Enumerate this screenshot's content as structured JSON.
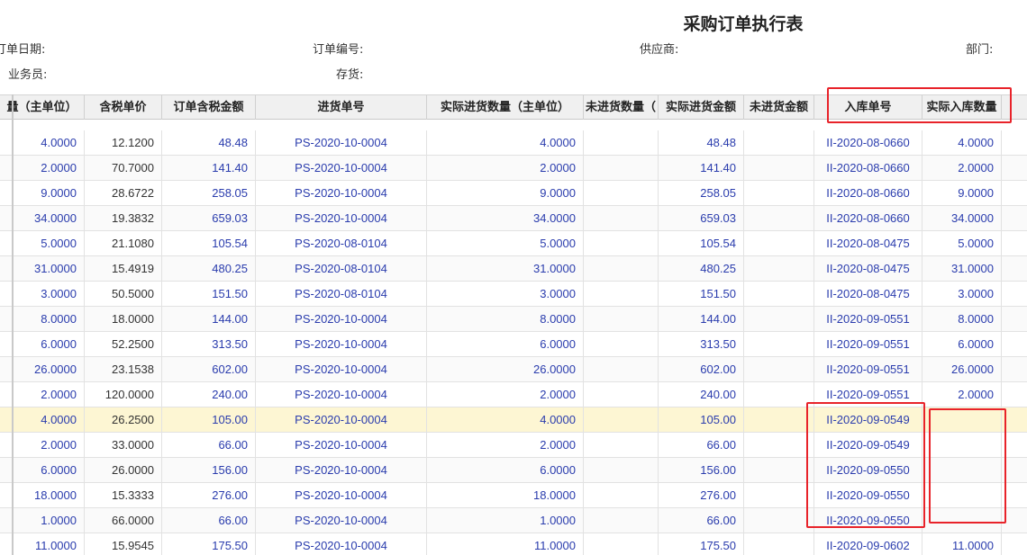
{
  "title": "采购订单执行表",
  "filters": {
    "order_date": "订单日期:",
    "order_no": "订单编号:",
    "supplier": "供应商:",
    "department": "部门:",
    "salesperson": "业务员:",
    "inventory": "存货:"
  },
  "columns": [
    "量（主单位）",
    "含税单价",
    "订单含税金额",
    "进货单号",
    "实际进货数量（主单位）",
    "未进货数量（",
    "实际进货金额",
    "未进货金额",
    "入库单号",
    "实际入库数量"
  ],
  "rows": [
    {
      "qty": "4.0000",
      "price": "12.1200",
      "amount": "48.48",
      "purchase_no": "PS-2020-10-0004",
      "actual_qty": "4.0000",
      "unpurchased_qty": "",
      "actual_amount": "48.48",
      "unpurchased_amount": "",
      "stockin_no": "II-2020-08-0660",
      "stockin_qty": "4.0000"
    },
    {
      "qty": "2.0000",
      "price": "70.7000",
      "amount": "141.40",
      "purchase_no": "PS-2020-10-0004",
      "actual_qty": "2.0000",
      "unpurchased_qty": "",
      "actual_amount": "141.40",
      "unpurchased_amount": "",
      "stockin_no": "II-2020-08-0660",
      "stockin_qty": "2.0000"
    },
    {
      "qty": "9.0000",
      "price": "28.6722",
      "amount": "258.05",
      "purchase_no": "PS-2020-10-0004",
      "actual_qty": "9.0000",
      "unpurchased_qty": "",
      "actual_amount": "258.05",
      "unpurchased_amount": "",
      "stockin_no": "II-2020-08-0660",
      "stockin_qty": "9.0000"
    },
    {
      "qty": "34.0000",
      "price": "19.3832",
      "amount": "659.03",
      "purchase_no": "PS-2020-10-0004",
      "actual_qty": "34.0000",
      "unpurchased_qty": "",
      "actual_amount": "659.03",
      "unpurchased_amount": "",
      "stockin_no": "II-2020-08-0660",
      "stockin_qty": "34.0000"
    },
    {
      "qty": "5.0000",
      "price": "21.1080",
      "amount": "105.54",
      "purchase_no": "PS-2020-08-0104",
      "actual_qty": "5.0000",
      "unpurchased_qty": "",
      "actual_amount": "105.54",
      "unpurchased_amount": "",
      "stockin_no": "II-2020-08-0475",
      "stockin_qty": "5.0000"
    },
    {
      "qty": "31.0000",
      "price": "15.4919",
      "amount": "480.25",
      "purchase_no": "PS-2020-08-0104",
      "actual_qty": "31.0000",
      "unpurchased_qty": "",
      "actual_amount": "480.25",
      "unpurchased_amount": "",
      "stockin_no": "II-2020-08-0475",
      "stockin_qty": "31.0000"
    },
    {
      "qty": "3.0000",
      "price": "50.5000",
      "amount": "151.50",
      "purchase_no": "PS-2020-08-0104",
      "actual_qty": "3.0000",
      "unpurchased_qty": "",
      "actual_amount": "151.50",
      "unpurchased_amount": "",
      "stockin_no": "II-2020-08-0475",
      "stockin_qty": "3.0000"
    },
    {
      "qty": "8.0000",
      "price": "18.0000",
      "amount": "144.00",
      "purchase_no": "PS-2020-10-0004",
      "actual_qty": "8.0000",
      "unpurchased_qty": "",
      "actual_amount": "144.00",
      "unpurchased_amount": "",
      "stockin_no": "II-2020-09-0551",
      "stockin_qty": "8.0000"
    },
    {
      "qty": "6.0000",
      "price": "52.2500",
      "amount": "313.50",
      "purchase_no": "PS-2020-10-0004",
      "actual_qty": "6.0000",
      "unpurchased_qty": "",
      "actual_amount": "313.50",
      "unpurchased_amount": "",
      "stockin_no": "II-2020-09-0551",
      "stockin_qty": "6.0000"
    },
    {
      "qty": "26.0000",
      "price": "23.1538",
      "amount": "602.00",
      "purchase_no": "PS-2020-10-0004",
      "actual_qty": "26.0000",
      "unpurchased_qty": "",
      "actual_amount": "602.00",
      "unpurchased_amount": "",
      "stockin_no": "II-2020-09-0551",
      "stockin_qty": "26.0000"
    },
    {
      "qty": "2.0000",
      "price": "120.0000",
      "amount": "240.00",
      "purchase_no": "PS-2020-10-0004",
      "actual_qty": "2.0000",
      "unpurchased_qty": "",
      "actual_amount": "240.00",
      "unpurchased_amount": "",
      "stockin_no": "II-2020-09-0551",
      "stockin_qty": "2.0000"
    },
    {
      "qty": "4.0000",
      "price": "26.2500",
      "amount": "105.00",
      "purchase_no": "PS-2020-10-0004",
      "actual_qty": "4.0000",
      "unpurchased_qty": "",
      "actual_amount": "105.00",
      "unpurchased_amount": "",
      "stockin_no": "II-2020-09-0549",
      "stockin_qty": ""
    },
    {
      "qty": "2.0000",
      "price": "33.0000",
      "amount": "66.00",
      "purchase_no": "PS-2020-10-0004",
      "actual_qty": "2.0000",
      "unpurchased_qty": "",
      "actual_amount": "66.00",
      "unpurchased_amount": "",
      "stockin_no": "II-2020-09-0549",
      "stockin_qty": ""
    },
    {
      "qty": "6.0000",
      "price": "26.0000",
      "amount": "156.00",
      "purchase_no": "PS-2020-10-0004",
      "actual_qty": "6.0000",
      "unpurchased_qty": "",
      "actual_amount": "156.00",
      "unpurchased_amount": "",
      "stockin_no": "II-2020-09-0550",
      "stockin_qty": ""
    },
    {
      "qty": "18.0000",
      "price": "15.3333",
      "amount": "276.00",
      "purchase_no": "PS-2020-10-0004",
      "actual_qty": "18.0000",
      "unpurchased_qty": "",
      "actual_amount": "276.00",
      "unpurchased_amount": "",
      "stockin_no": "II-2020-09-0550",
      "stockin_qty": ""
    },
    {
      "qty": "1.0000",
      "price": "66.0000",
      "amount": "66.00",
      "purchase_no": "PS-2020-10-0004",
      "actual_qty": "1.0000",
      "unpurchased_qty": "",
      "actual_amount": "66.00",
      "unpurchased_amount": "",
      "stockin_no": "II-2020-09-0550",
      "stockin_qty": ""
    },
    {
      "qty": "11.0000",
      "price": "15.9545",
      "amount": "175.50",
      "purchase_no": "PS-2020-10-0004",
      "actual_qty": "11.0000",
      "unpurchased_qty": "",
      "actual_amount": "175.50",
      "unpurchased_amount": "",
      "stockin_no": "II-2020-09-0602",
      "stockin_qty": "11.0000"
    }
  ],
  "highlighted_row": 11,
  "colors": {
    "link_blue": "#2a3cad",
    "highlight_row": "#fdf6d3",
    "annotation_red": "#e8232a"
  }
}
